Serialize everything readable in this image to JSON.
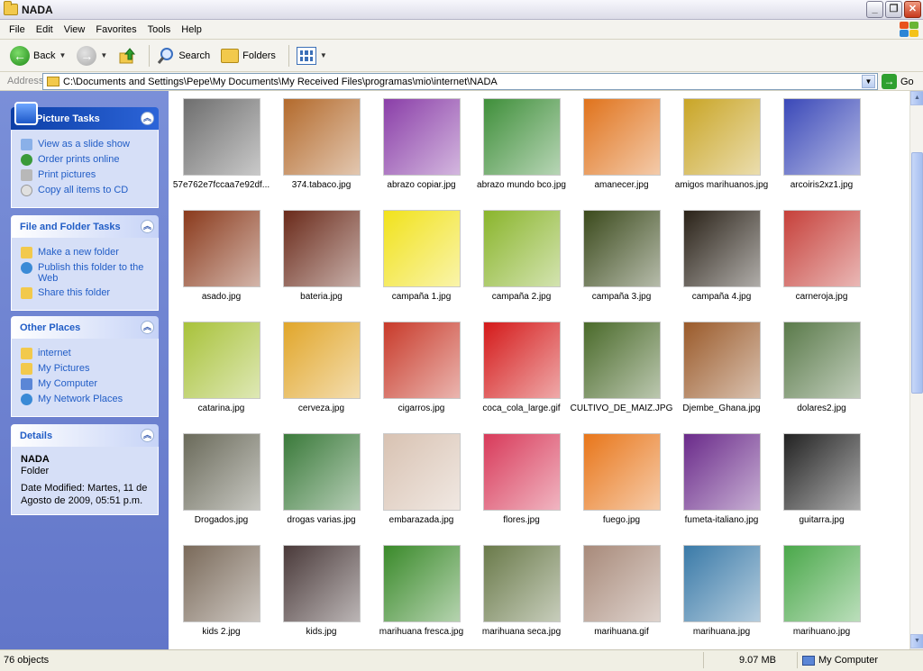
{
  "window": {
    "title": "NADA"
  },
  "menu": [
    "File",
    "Edit",
    "View",
    "Favorites",
    "Tools",
    "Help"
  ],
  "toolbar": {
    "back": "Back",
    "search": "Search",
    "folders": "Folders"
  },
  "address": {
    "label": "Address",
    "path": "C:\\Documents and Settings\\Pepe\\My Documents\\My Received Files\\programas\\mio\\internet\\NADA",
    "go": "Go"
  },
  "picture_tasks": {
    "title": "Picture Tasks",
    "items": [
      "View as a slide show",
      "Order prints online",
      "Print pictures",
      "Copy all items to CD"
    ]
  },
  "file_tasks": {
    "title": "File and Folder Tasks",
    "items": [
      "Make a new folder",
      "Publish this folder to the Web",
      "Share this folder"
    ]
  },
  "other_places": {
    "title": "Other Places",
    "items": [
      "internet",
      "My Pictures",
      "My Computer",
      "My Network Places"
    ]
  },
  "details": {
    "title": "Details",
    "name": "NADA",
    "type": "Folder",
    "modified": "Date Modified: Martes, 11 de Agosto de 2009, 05:51 p.m."
  },
  "files": [
    {
      "name": "57e762e7fccaa7e92df...",
      "color": "#6e6e6e"
    },
    {
      "name": "374.tabaco.jpg",
      "color": "#b36a2c"
    },
    {
      "name": "abrazo copiar.jpg",
      "color": "#8a3ea8"
    },
    {
      "name": "abrazo mundo bco.jpg",
      "color": "#3f8f3a"
    },
    {
      "name": "amanecer.jpg",
      "color": "#e0731c"
    },
    {
      "name": "amigos marihuanos.jpg",
      "color": "#c9a526"
    },
    {
      "name": "arcoiris2xz1.jpg",
      "color": "#3a48b8"
    },
    {
      "name": "asado.jpg",
      "color": "#8a3a1c"
    },
    {
      "name": "bateria.jpg",
      "color": "#6a2a1a"
    },
    {
      "name": "campaña 1.jpg",
      "color": "#f1e21c"
    },
    {
      "name": "campaña 2.jpg",
      "color": "#8ab52c"
    },
    {
      "name": "campaña 3.jpg",
      "color": "#3b4a1c"
    },
    {
      "name": "campaña 4.jpg",
      "color": "#2a2218"
    },
    {
      "name": "carneroja.jpg",
      "color": "#c6403a"
    },
    {
      "name": "catarina.jpg",
      "color": "#a8c23a"
    },
    {
      "name": "cerveza.jpg",
      "color": "#e1a62a"
    },
    {
      "name": "cigarros.jpg",
      "color": "#c83a2a"
    },
    {
      "name": "coca_cola_large.gif",
      "color": "#d41a1a"
    },
    {
      "name": "CULTIVO_DE_MAIZ.JPG",
      "color": "#4a6a2a"
    },
    {
      "name": "Djembe_Ghana.jpg",
      "color": "#9a5a2a"
    },
    {
      "name": "dolares2.jpg",
      "color": "#5a7a4a"
    },
    {
      "name": "Drogados.jpg",
      "color": "#6a6a5a"
    },
    {
      "name": "drogas varias.jpg",
      "color": "#3a7a3a"
    },
    {
      "name": "embarazada.jpg",
      "color": "#d8c2b2"
    },
    {
      "name": "flores.jpg",
      "color": "#d83a5a"
    },
    {
      "name": "fuego.jpg",
      "color": "#e8761a"
    },
    {
      "name": "fumeta-italiano.jpg",
      "color": "#6a2a8a"
    },
    {
      "name": "guitarra.jpg",
      "color": "#222222"
    },
    {
      "name": "kids 2.jpg",
      "color": "#7a6a5a"
    },
    {
      "name": "kids.jpg",
      "color": "#4a3a3a"
    },
    {
      "name": "marihuana fresca.jpg",
      "color": "#3a8a2a"
    },
    {
      "name": "marihuana seca.jpg",
      "color": "#6a7a4a"
    },
    {
      "name": "marihuana.gif",
      "color": "#a88a7a"
    },
    {
      "name": "marihuana.jpg",
      "color": "#3a7aa8"
    },
    {
      "name": "marihuano.jpg",
      "color": "#4aa84a"
    }
  ],
  "status": {
    "objects": "76 objects",
    "size": "9.07 MB",
    "location": "My Computer"
  }
}
